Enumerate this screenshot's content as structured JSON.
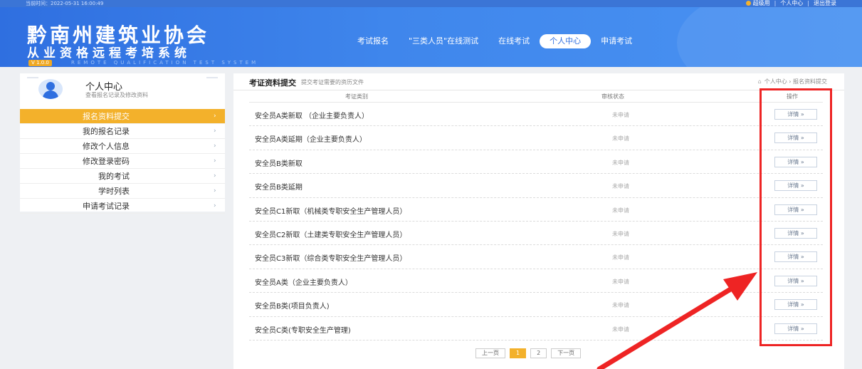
{
  "topbar": {
    "time_text": "当前时间：2022-05-31 16:00:49",
    "user": "超级用",
    "links": [
      "个人中心",
      "退出登录"
    ]
  },
  "header": {
    "title": "黔南州建筑业协会",
    "subtitle": "从业资格远程考培系统",
    "version": "V 1.0.0",
    "english": "REMOTE QUALIFICATION TEST SYSTEM",
    "nav": [
      "考试报名",
      "\"三类人员\"在线测试",
      "在线考试",
      "个人中心",
      "申请考试"
    ],
    "active_nav_index": 3
  },
  "sidebar": {
    "title": "个人中心",
    "desc": "查看报名记录及修改资料",
    "items": [
      {
        "label": "报名资料提交",
        "active": true
      },
      {
        "label": "我的报名记录"
      },
      {
        "label": "修改个人信息"
      },
      {
        "label": "修改登录密码"
      },
      {
        "label": "我的考试"
      },
      {
        "label": "学时列表"
      },
      {
        "label": "申请考试记录"
      }
    ]
  },
  "panel": {
    "title": "考证资料提交",
    "desc": "提交考证需要的资历文件",
    "breadcrumb": "个人中心 › 报名资料提交",
    "columns": [
      "考证类别",
      "审核状态",
      "操作"
    ],
    "rows": [
      {
        "name": "安全员A类新取 （企业主要负责人）",
        "status": "未申请",
        "action": "详情 »"
      },
      {
        "name": "安全员A类延期（企业主要负责人）",
        "status": "未申请",
        "action": "详情 »"
      },
      {
        "name": "安全员B类新取",
        "status": "未申请",
        "action": "详情 »"
      },
      {
        "name": "安全员B类延期",
        "status": "未申请",
        "action": "详情 »"
      },
      {
        "name": "安全员C1新取（机械类专职安全生产管理人员）",
        "status": "未申请",
        "action": "详情 »"
      },
      {
        "name": "安全员C2新取（土建类专职安全生产管理人员）",
        "status": "未申请",
        "action": "详情 »"
      },
      {
        "name": "安全员C3新取（综合类专职安全生产管理人员）",
        "status": "未申请",
        "action": "详情 »"
      },
      {
        "name": "安全员A类（企业主要负责人）",
        "status": "未申请",
        "action": "详情 »"
      },
      {
        "name": "安全员B类(项目负责人)",
        "status": "未申请",
        "action": "详情 »"
      },
      {
        "name": "安全员C类(专职安全生产管理)",
        "status": "未申请",
        "action": "详情 »"
      }
    ],
    "pager": {
      "prev": "上一页",
      "pages": [
        "1",
        "2"
      ],
      "current": "1",
      "next": "下一页"
    }
  },
  "colors": {
    "primary": "#2f6fe0",
    "accent": "#f3b12b",
    "annotation": "#ee2424"
  }
}
